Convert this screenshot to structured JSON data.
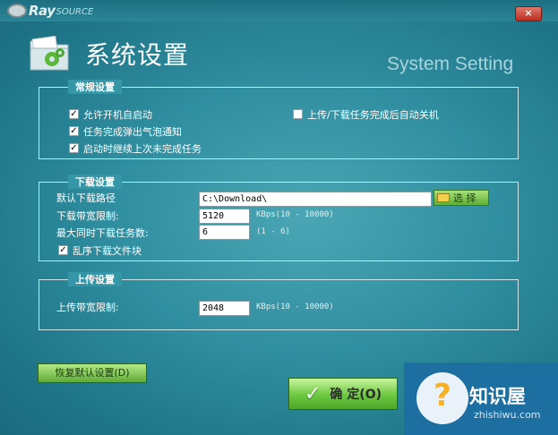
{
  "app": {
    "logo_main": "Ray",
    "logo_sub": "SOURCE",
    "close_label": "×"
  },
  "header": {
    "title": "系统设置",
    "subtitle": "System Setting"
  },
  "general": {
    "title": "常规设置",
    "options": [
      {
        "label": "允许开机自启动",
        "checked": true
      },
      {
        "label": "任务完成弹出气泡通知",
        "checked": true
      },
      {
        "label": "启动时继续上次未完成任务",
        "checked": true
      },
      {
        "label": "上传/下载任务完成后自动关机",
        "checked": false
      }
    ]
  },
  "download": {
    "title": "下载设置",
    "path_label": "默认下载路径",
    "path_value": "C:\\Download\\",
    "browse_label": "选 择",
    "bandwidth_label": "下载带宽限制:",
    "bandwidth_value": "5120",
    "bandwidth_unit": "KBps(10 - 10000)",
    "max_tasks_label": "最大同时下载任务数:",
    "max_tasks_value": "6",
    "max_tasks_range": "(1 - 6)",
    "shuffle_label": "乱序下载文件块",
    "shuffle_checked": true
  },
  "upload": {
    "title": "上传设置",
    "bandwidth_label": "上传带宽限制:",
    "bandwidth_value": "2048",
    "bandwidth_unit": "KBps(10 - 10000)"
  },
  "buttons": {
    "reset_label": "恢复默认设置(D)",
    "ok_label": "确 定(O)"
  },
  "watermark": {
    "name": "知识屋",
    "url": "zhishiwu.com"
  }
}
